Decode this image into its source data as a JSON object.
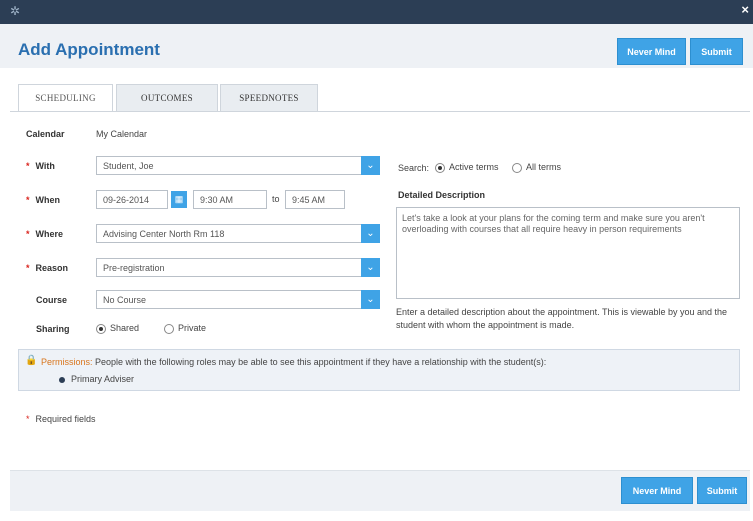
{
  "window": {
    "logo": "✲",
    "close": "×"
  },
  "header": {
    "title": "Add Appointment",
    "never_mind": "Never Mind",
    "submit": "Submit"
  },
  "tabs": [
    {
      "label": "SCHEDULING",
      "active": true
    },
    {
      "label": "OUTCOMES",
      "active": false
    },
    {
      "label": "SPEEDNOTES",
      "active": false
    }
  ],
  "form": {
    "calendar_label": "Calendar",
    "calendar_value": "My Calendar",
    "with_label": "With",
    "with_value": "Student, Joe",
    "when_label": "When",
    "when_date": "09-26-2014",
    "when_start": "9:30 AM",
    "to_label": "to",
    "when_end": "9:45 AM",
    "where_label": "Where",
    "where_value": "Advising Center North Rm 118",
    "reason_label": "Reason",
    "reason_value": "Pre-registration",
    "course_label": "Course",
    "course_value": "No Course",
    "sharing_label": "Sharing",
    "sharing_shared": "Shared",
    "sharing_private": "Private",
    "sharing_selected": "Shared",
    "required_star": "*"
  },
  "search": {
    "label": "Search:",
    "active_terms": "Active terms",
    "all_terms": "All terms",
    "selected": "Active terms"
  },
  "description": {
    "label": "Detailed Description",
    "value": "Let's take a look at your plans for the coming term and make sure you aren't overloading with courses that all require heavy in person requirements",
    "help": "Enter a detailed description about the appointment. This is viewable by you and the student with whom the appointment is made."
  },
  "permissions": {
    "key": "Permissions:",
    "text": "People with the following roles may be able to see this appointment if they have a relationship with the student(s):",
    "roles": [
      "Primary Adviser"
    ]
  },
  "required_note": "Required fields",
  "footer": {
    "never_mind": "Never Mind",
    "submit": "Submit"
  },
  "colors": {
    "accent": "#3fa3e6",
    "title": "#2a6fb0",
    "titlebar": "#2c3e55",
    "required": "#d9241d"
  }
}
